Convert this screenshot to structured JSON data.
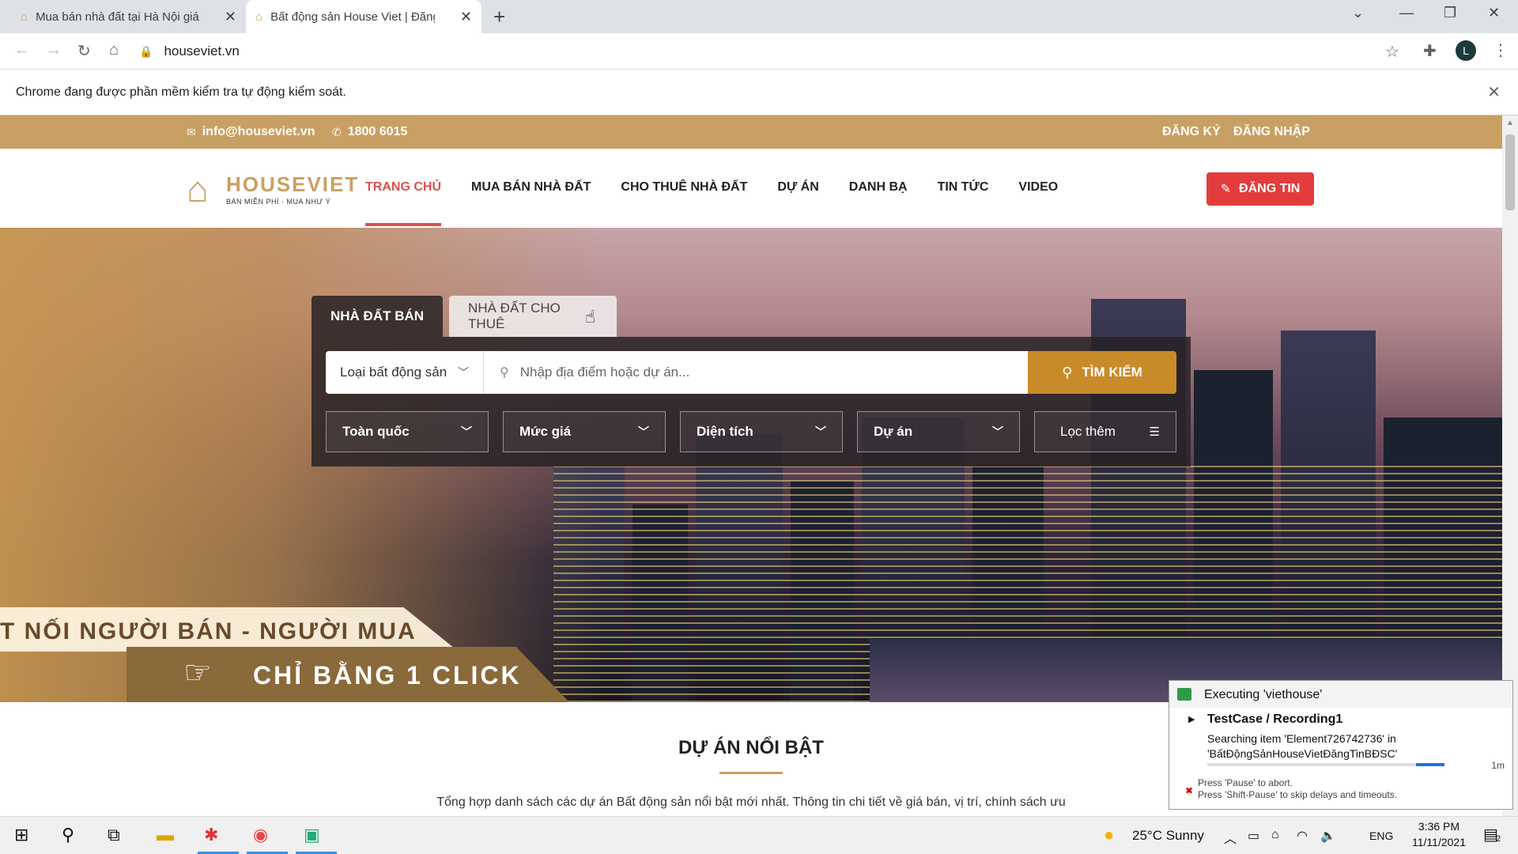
{
  "browser": {
    "tabs": [
      {
        "title": "Mua bán nhà đất tại Hà Nội giá r",
        "active": false
      },
      {
        "title": "Bất động sản House Viet | Đăng t",
        "active": true
      }
    ],
    "url": "houseviet.vn",
    "automation_notice": "Chrome đang được phần mềm kiểm tra tự động kiểm soát.",
    "profile_initial": "L"
  },
  "site": {
    "contact": {
      "email": "info@houseviet.vn",
      "phone": "1800 6015"
    },
    "auth": {
      "register": "ĐĂNG KÝ",
      "login": "ĐĂNG NHẬP"
    },
    "logo": {
      "name": "HOUSEVIET",
      "tagline": "BÁN MIỄN PHÍ · MUA NHƯ Ý"
    },
    "menu": [
      "TRANG CHỦ",
      "MUA BÁN NHÀ ĐẤT",
      "CHO THUÊ NHÀ ĐẤT",
      "DỰ ÁN",
      "DANH BẠ",
      "TIN TỨC",
      "VIDEO"
    ],
    "post_button": "ĐĂNG TIN",
    "search": {
      "tab_sale": "NHÀ ĐẤT BÁN",
      "tab_rent": "NHÀ ĐẤT CHO THUÊ",
      "type_select": "Loại bất động sản",
      "placeholder": "Nhập địa điểm hoặc dự án...",
      "button": "TÌM KIẾM",
      "filters": [
        "Toàn quốc",
        "Mức giá",
        "Diện tích",
        "Dự án"
      ],
      "more_filters": "Lọc thêm"
    },
    "banner": {
      "line1": "T NỐI NGƯỜI BÁN - NGƯỜI MUA",
      "line2": "CHỈ BẰNG 1 CLICK"
    },
    "featured": {
      "title": "DỰ ÁN NỔI BẬT",
      "description": "Tổng hợp danh sách các dự án Bất động sản nổi bật mới nhất. Thông tin chi tiết về giá bán, vị trí, chính sách ưu"
    }
  },
  "katalon": {
    "executing": "Executing 'viethouse'",
    "testcase": "TestCase / Recording1",
    "searching_line1": "Searching item 'Element726742736' in",
    "searching_line2": "'BấtĐộngSảnHouseVietĐăngTinBĐSC'",
    "progress": 0.12,
    "duration": "1m",
    "hint_line1": "Press 'Pause' to abort.",
    "hint_line2": "Press 'Shift-Pause' to skip delays and timeouts."
  },
  "taskbar": {
    "weather": "25°C  Sunny",
    "language": "ENG",
    "time": "3:36 PM",
    "date": "11/11/2021",
    "notifications": "2"
  }
}
